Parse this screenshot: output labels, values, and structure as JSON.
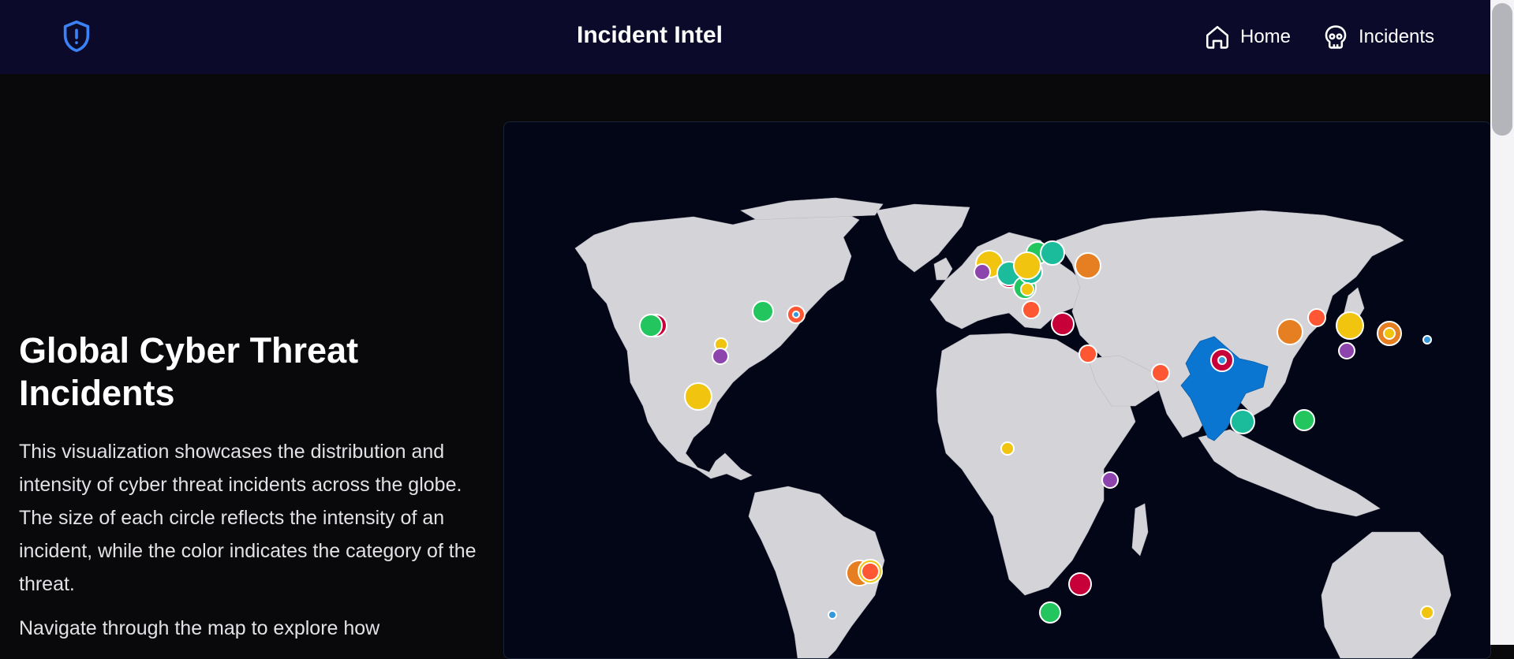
{
  "header": {
    "title": "Incident Intel",
    "nav": [
      {
        "label": "Home",
        "icon": "home-icon"
      },
      {
        "label": "Incidents",
        "icon": "skull-icon"
      }
    ],
    "logo_icon": "shield-alert-icon"
  },
  "intro": {
    "heading": "Global Cyber Threat Incidents",
    "paragraphs": [
      "This visualization showcases the distribution and intensity of cyber threat incidents across the globe. The size of each circle reflects the intensity of an incident, while the color indicates the category of the threat.",
      "Navigate through the map to explore how"
    ]
  },
  "map": {
    "highlighted_country": "India",
    "land_color": "#d4d4d8",
    "ocean_color": "#030617",
    "highlight_color": "#0b76d1",
    "category_colors": [
      "#22c55e",
      "#f1c40f",
      "#e67e22",
      "#ff5733",
      "#c70039",
      "#8e44ad",
      "#1abc9c",
      "#3498db"
    ]
  },
  "colors": {
    "navbar": "#0b0a2a",
    "background": "#09090b",
    "accent": "#3b82f6"
  }
}
